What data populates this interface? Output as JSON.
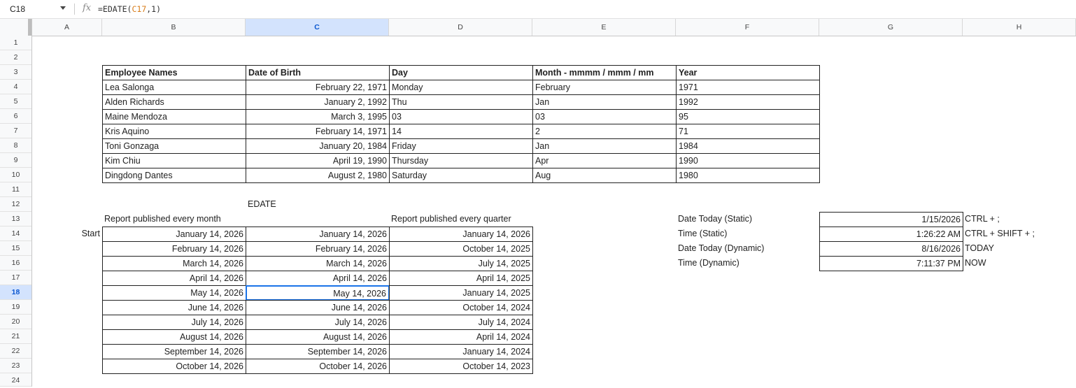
{
  "formula_bar": {
    "name_box": "C18",
    "fx_label": "fx",
    "formula_prefix": "=EDATE(",
    "formula_ref": "C17",
    "formula_suffix": ",1)"
  },
  "columns": [
    "A",
    "B",
    "C",
    "D",
    "E",
    "F",
    "G",
    "H"
  ],
  "active_column": "C",
  "rows": [
    "1",
    "2",
    "3",
    "4",
    "5",
    "6",
    "7",
    "8",
    "9",
    "10",
    "11",
    "12",
    "13",
    "14",
    "15",
    "16",
    "17",
    "18",
    "19",
    "20",
    "21",
    "22",
    "23",
    "24"
  ],
  "active_row": "18",
  "employee_table": {
    "headers": [
      "Employee Names",
      "Date of Birth",
      "Day",
      "Month - mmmm / mmm / mm",
      "Year"
    ],
    "rows": [
      [
        "Lea Salonga",
        "February 22, 1971",
        "Monday",
        "February",
        "1971"
      ],
      [
        "Alden Richards",
        "January 2, 1992",
        "Thu",
        "Jan",
        "1992"
      ],
      [
        "Maine Mendoza",
        "March 3, 1995",
        "03",
        "03",
        "95"
      ],
      [
        "Kris Aquino",
        "February 14, 1971",
        "14",
        "2",
        "71"
      ],
      [
        "Toni Gonzaga",
        "January 20, 1984",
        "Friday",
        "Jan",
        "1984"
      ],
      [
        "Kim Chiu",
        "April 19, 1990",
        "Thursday",
        "Apr",
        "1990"
      ],
      [
        "Dingdong Dantes",
        "August 2, 1980",
        "Saturday",
        "Aug",
        "1980"
      ]
    ]
  },
  "edate_section": {
    "title": "EDATE",
    "monthly_label": "Report published every month",
    "quarterly_label": "Report published every quarter",
    "start_label": "Start",
    "rows": [
      [
        "January 14, 2026",
        "January 14, 2026",
        "January 14, 2026"
      ],
      [
        "February 14, 2026",
        "February 14, 2026",
        "October 14, 2025"
      ],
      [
        "March 14, 2026",
        "March 14, 2026",
        "July 14, 2025"
      ],
      [
        "April 14, 2026",
        "April 14, 2026",
        "April 14, 2025"
      ],
      [
        "May 14, 2026",
        "May 14, 2026",
        "January 14, 2025"
      ],
      [
        "June 14, 2026",
        "June 14, 2026",
        "October 14, 2024"
      ],
      [
        "July 14, 2026",
        "July 14, 2026",
        "July 14, 2024"
      ],
      [
        "August 14, 2026",
        "August 14, 2026",
        "April 14, 2024"
      ],
      [
        "September 14, 2026",
        "September 14, 2026",
        "January 14, 2024"
      ],
      [
        "October 14, 2026",
        "October 14, 2026",
        "October 14, 2023"
      ]
    ]
  },
  "date_time_section": {
    "rows": [
      [
        "Date Today (Static)",
        "1/15/2026",
        "CTRL + ;"
      ],
      [
        "Time (Static)",
        "1:26:22 AM",
        "CTRL + SHIFT + ;"
      ],
      [
        "Date Today (Dynamic)",
        "8/16/2026",
        "TODAY"
      ],
      [
        "Time (Dynamic)",
        "7:11:37 PM",
        "NOW"
      ]
    ]
  },
  "colors": {
    "selection": "#1a73e8",
    "header_active_bg": "#d3e3fd",
    "header_bg": "#f8f9fa",
    "formula_ref": "#d87d1a"
  }
}
